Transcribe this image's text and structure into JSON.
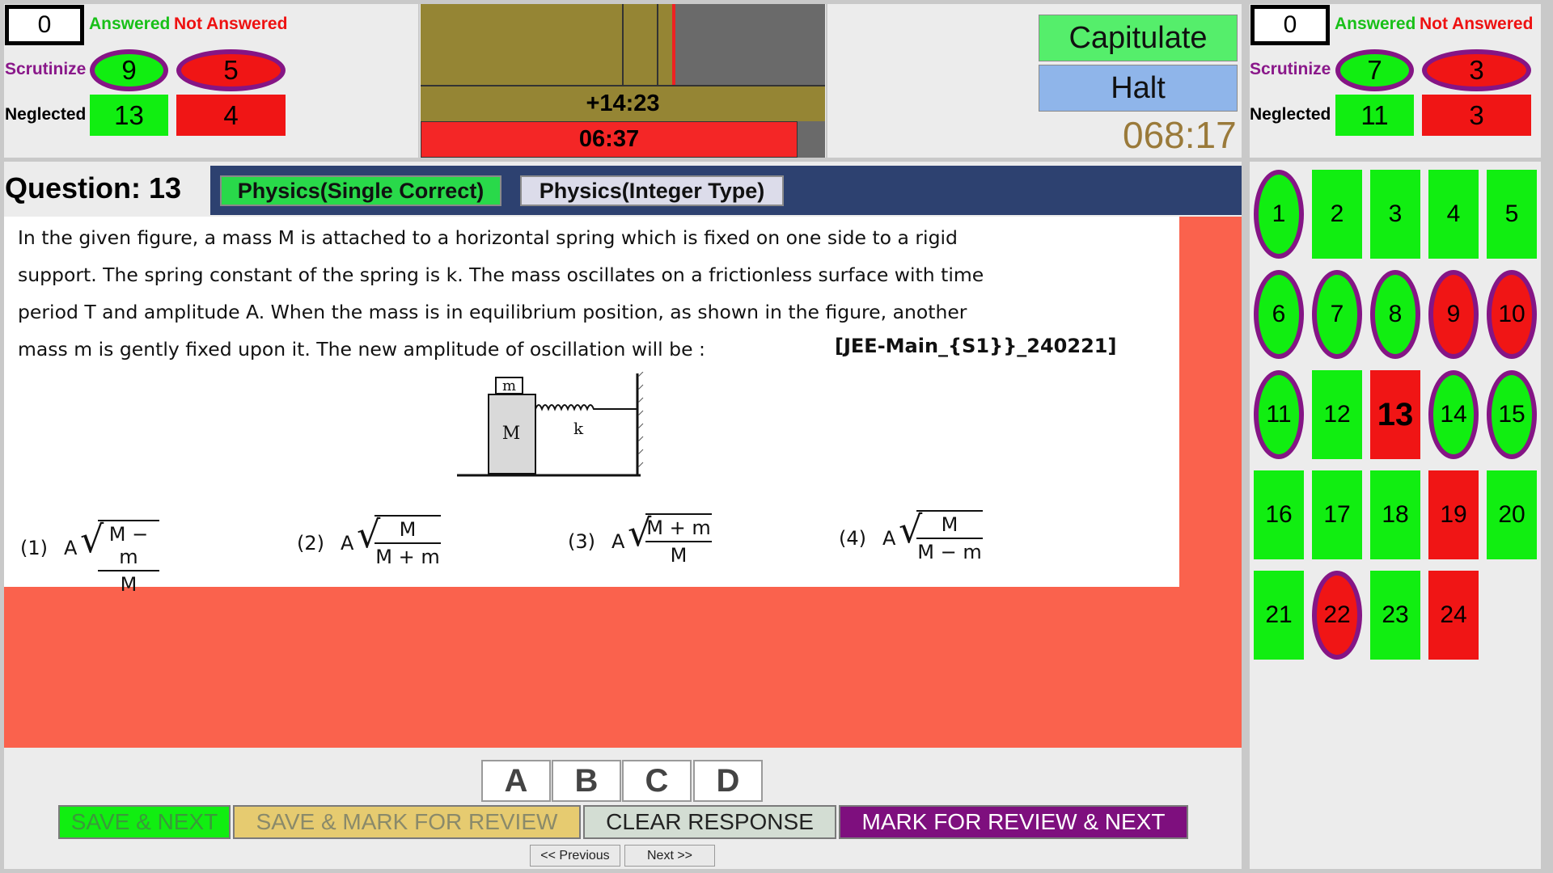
{
  "colors": {
    "answered": "#11ee11",
    "not_answered": "#f01515",
    "review_ring": "#851585",
    "question_area": "#fa624d",
    "header_bar": "#2d4170",
    "capitulate_bg": "#55ee6b",
    "halt_bg": "#8fb5ea",
    "mark_review_bg": "#7e0f7e"
  },
  "left_stats": {
    "count": "0",
    "answered_label": "Answered",
    "not_answered_label": "Not Answered",
    "scrutinize_label": "Scrutinize",
    "scrutinize_answered": "9",
    "scrutinize_not_answered": "5",
    "neglected_label": "Neglected",
    "neglected_answered": "13",
    "neglected_not_answered": "4"
  },
  "right_stats": {
    "count": "0",
    "answered_label": "Answered",
    "not_answered_label": "Not Answered",
    "scrutinize_label": "Scrutinize",
    "scrutinize_answered": "7",
    "scrutinize_not_answered": "3",
    "neglected_label": "Neglected",
    "neglected_answered": "11",
    "neglected_not_answered": "3"
  },
  "timer": {
    "offset": "+14:23",
    "countdown": "06:37"
  },
  "controls": {
    "capitulate": "Capitulate",
    "halt": "Halt",
    "clock": "068:17"
  },
  "question": {
    "title": "Question: 13",
    "tabs": [
      "Physics(Single Correct)",
      "Physics(Integer Type)"
    ],
    "text_lines": [
      "In the given figure, a mass M is attached to a horizontal spring which is fixed on one side to a rigid",
      "support. The spring constant of the spring is k. The mass oscillates on a frictionless surface with time",
      "period T and amplitude A. When the mass is in equilibrium position, as shown in the figure, another",
      "mass m is gently fixed upon it. The new amplitude of oscillation will be :"
    ],
    "source": "[JEE-Main_{S1}}_240221]",
    "figure": {
      "small_mass": "m",
      "big_mass": "M",
      "spring": "k"
    },
    "options": [
      {
        "label": "(1)",
        "prefix": "A",
        "num": "M − m",
        "den": "M"
      },
      {
        "label": "(2)",
        "prefix": "A",
        "num": "M",
        "den": "M + m"
      },
      {
        "label": "(3)",
        "prefix": "A",
        "num": "M + m",
        "den": "M"
      },
      {
        "label": "(4)",
        "prefix": "A",
        "num": "M",
        "den": "M − m"
      }
    ]
  },
  "answer_options": [
    "A",
    "B",
    "C",
    "D"
  ],
  "actions": {
    "save_next": "SAVE & NEXT",
    "save_mark": "SAVE & MARK FOR REVIEW",
    "clear": "CLEAR RESPONSE",
    "mark_next": "MARK FOR REVIEW & NEXT",
    "previous": "<< Previous",
    "next": "Next >>"
  },
  "palette": [
    {
      "n": "1",
      "status": "answered",
      "review": true
    },
    {
      "n": "2",
      "status": "answered",
      "review": false
    },
    {
      "n": "3",
      "status": "answered",
      "review": false
    },
    {
      "n": "4",
      "status": "answered",
      "review": false
    },
    {
      "n": "5",
      "status": "answered",
      "review": false
    },
    {
      "n": "6",
      "status": "answered",
      "review": true
    },
    {
      "n": "7",
      "status": "answered",
      "review": true
    },
    {
      "n": "8",
      "status": "answered",
      "review": true
    },
    {
      "n": "9",
      "status": "not_answered",
      "review": true
    },
    {
      "n": "10",
      "status": "not_answered",
      "review": true
    },
    {
      "n": "11",
      "status": "answered",
      "review": true
    },
    {
      "n": "12",
      "status": "answered",
      "review": false
    },
    {
      "n": "13",
      "status": "not_answered",
      "review": false,
      "current": true
    },
    {
      "n": "14",
      "status": "answered",
      "review": true
    },
    {
      "n": "15",
      "status": "answered",
      "review": true
    },
    {
      "n": "16",
      "status": "answered",
      "review": false
    },
    {
      "n": "17",
      "status": "answered",
      "review": false
    },
    {
      "n": "18",
      "status": "answered",
      "review": false
    },
    {
      "n": "19",
      "status": "not_answered",
      "review": false
    },
    {
      "n": "20",
      "status": "answered",
      "review": false
    },
    {
      "n": "21",
      "status": "answered",
      "review": false
    },
    {
      "n": "22",
      "status": "not_answered",
      "review": true
    },
    {
      "n": "23",
      "status": "answered",
      "review": false
    },
    {
      "n": "24",
      "status": "not_answered",
      "review": false
    }
  ]
}
